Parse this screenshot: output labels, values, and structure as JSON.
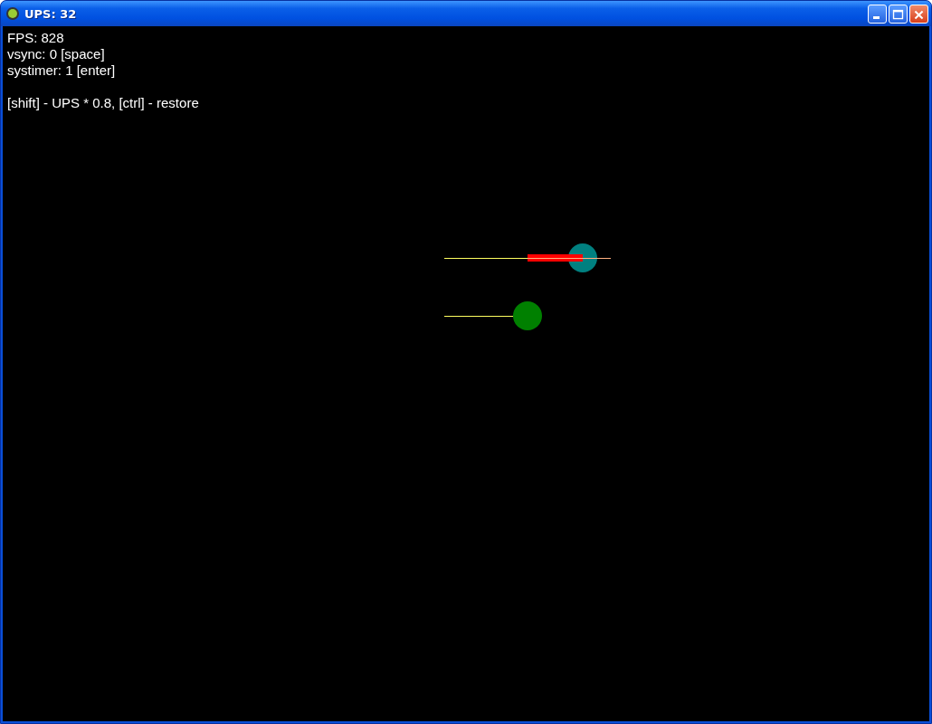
{
  "window": {
    "title": "UPS: 32"
  },
  "status_lines": [
    {
      "text": "FPS: 828"
    },
    {
      "text": "vsync: 0 [space]"
    },
    {
      "text": "systimer: 1 [enter]"
    }
  ],
  "help_line": {
    "text": "[shift] - UPS * 0.8, [ctrl] - restore"
  }
}
